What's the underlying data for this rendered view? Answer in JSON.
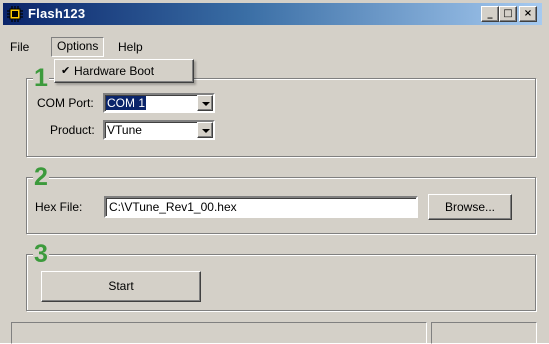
{
  "window": {
    "title": "Flash123"
  },
  "title_buttons": {
    "minimize": "_",
    "maximize": "□",
    "close": "×"
  },
  "menu": {
    "file": "File",
    "options": "Options",
    "help": "Help"
  },
  "options_menu": {
    "hardware_boot": {
      "label": "Hardware Boot",
      "checked": true,
      "check_glyph": "✔"
    }
  },
  "step1": {
    "number": "1",
    "com_port_label": "COM Port:",
    "com_port_value": "COM 1",
    "product_label": "Product:",
    "product_value": "VTune"
  },
  "step2": {
    "number": "2",
    "hex_file_label": "Hex File:",
    "hex_file_value": "C:\\VTune_Rev1_00.hex",
    "browse_label": "Browse..."
  },
  "step3": {
    "number": "3",
    "start_label": "Start"
  },
  "colors": {
    "title_start": "#0a246a",
    "title_end": "#a6caf0",
    "step_number": "#3c9a3c",
    "face": "#d4d0c8"
  }
}
